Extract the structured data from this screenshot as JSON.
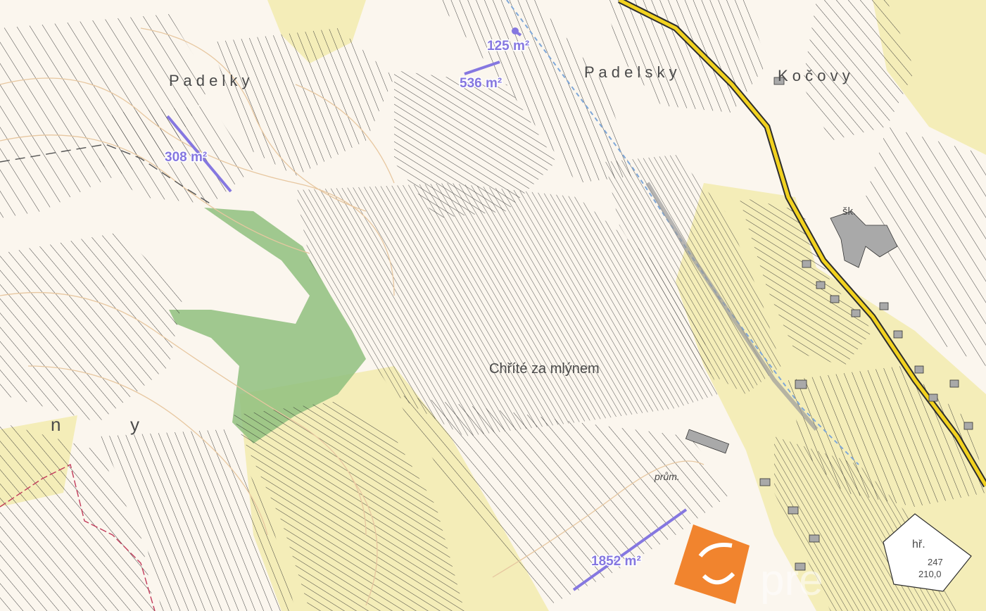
{
  "map": {
    "place_names": {
      "padelky_west": "P a d e l k y",
      "padelsky": "P a d e l s k y",
      "kocovy": "K o č o v y",
      "chrite_za_mlynem": "Chříté za mlýnem",
      "y_fragment": "y",
      "ny_fragment": "n",
      "sk": "šk.",
      "prum": "prům.",
      "hr": "hř.",
      "hr_number": "247",
      "hr_elevation": "210,0"
    },
    "area_labels": {
      "parcel_125": "125 m²",
      "parcel_536": "536 m²",
      "parcel_308": "308 m²",
      "parcel_1852": "1852 m²"
    },
    "watermark": {
      "brand": "pre"
    },
    "colors": {
      "background": "#fbf6ee",
      "parcel_line": "#2d2d2d",
      "contour": "#e7c7a0",
      "forest": "#8fbf7e",
      "field_yellow": "#f3ecb1",
      "road_yellow": "#f2d21f",
      "building_grey": "#a9a9a9",
      "measurement": "#8577e0",
      "logo_orange": "#f07a1d"
    }
  }
}
